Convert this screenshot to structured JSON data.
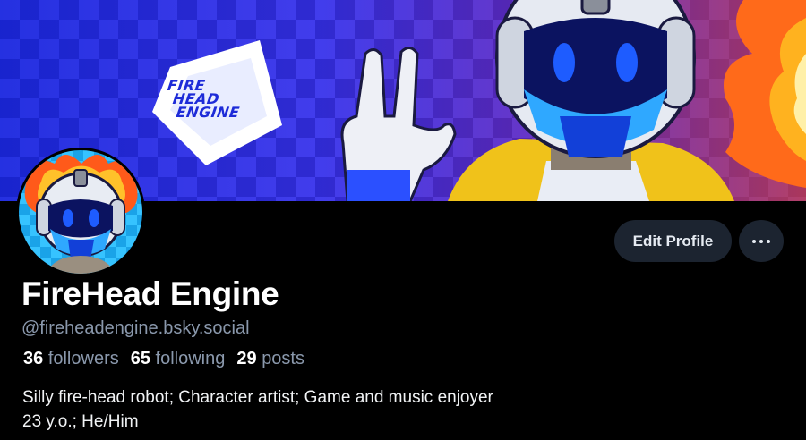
{
  "banner": {
    "logo_lines": [
      "FIRE",
      "HEAD",
      "ENGINE"
    ]
  },
  "profile": {
    "display_name": "FireHead Engine",
    "handle": "@fireheadengine.bsky.social",
    "followers_count": "36",
    "followers_label": "followers",
    "following_count": "65",
    "following_label": "following",
    "posts_count": "29",
    "posts_label": "posts",
    "bio_lines": [
      "Silly fire-head robot; Character artist; Game and music enjoyer",
      "23 y.o.; He/Him"
    ]
  },
  "actions": {
    "edit_profile_label": "Edit Profile",
    "more_icon": "more-horizontal-icon"
  },
  "colors": {
    "background": "#000000",
    "button_bg": "#1c2430",
    "muted_text": "#8a98ac",
    "banner_blue": "#1e2cd6",
    "flame_orange": "#ff6a1a"
  }
}
